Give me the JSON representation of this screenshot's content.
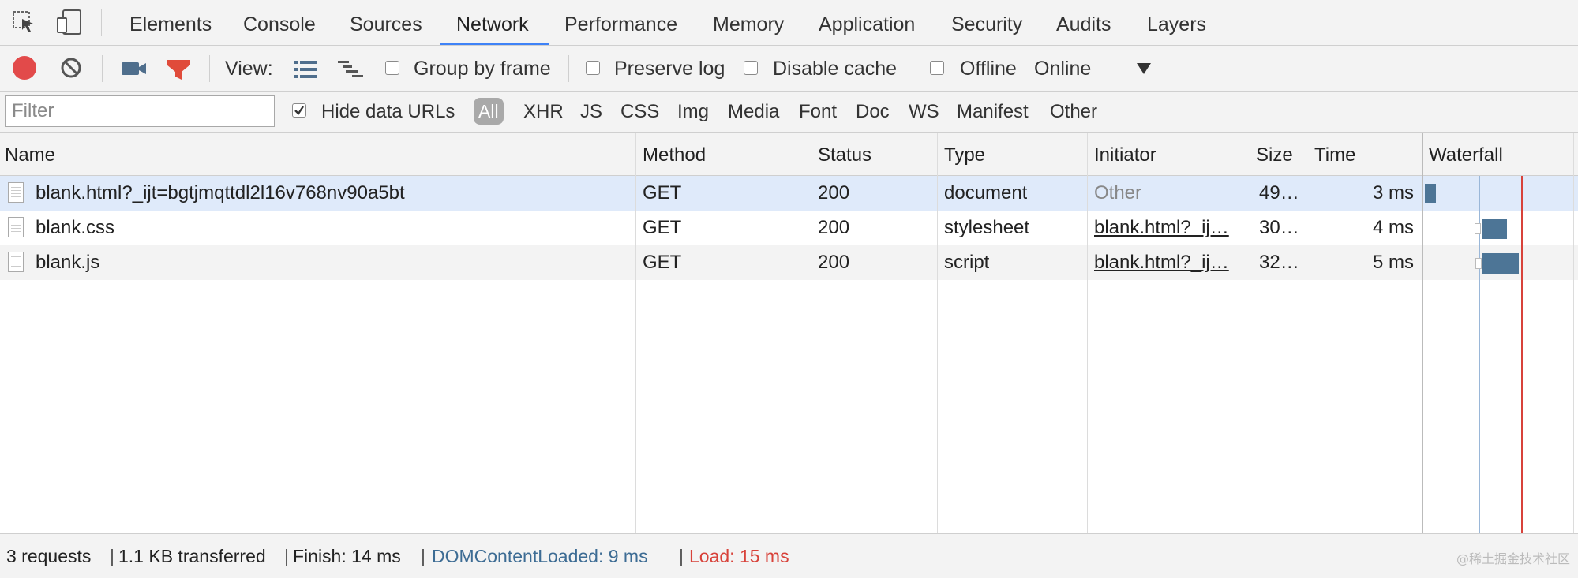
{
  "tabs": [
    {
      "label": "Elements"
    },
    {
      "label": "Console"
    },
    {
      "label": "Sources"
    },
    {
      "label": "Network",
      "active": true
    },
    {
      "label": "Performance"
    },
    {
      "label": "Memory"
    },
    {
      "label": "Application"
    },
    {
      "label": "Security"
    },
    {
      "label": "Audits"
    },
    {
      "label": "Layers"
    }
  ],
  "toolbar": {
    "view_label": "View:",
    "group_by_frame": "Group by frame",
    "preserve_log": "Preserve log",
    "disable_cache": "Disable cache",
    "offline": "Offline",
    "throttling": "Online"
  },
  "filter": {
    "placeholder": "Filter",
    "hide_data_urls": "Hide data URLs",
    "types": [
      "All",
      "XHR",
      "JS",
      "CSS",
      "Img",
      "Media",
      "Font",
      "Doc",
      "WS",
      "Manifest",
      "Other"
    ]
  },
  "columns": [
    "Name",
    "Method",
    "Status",
    "Type",
    "Initiator",
    "Size",
    "Time",
    "Waterfall"
  ],
  "rows": [
    {
      "name": "blank.html?_ijt=bgtjmqttdl2l16v768nv90a5bt",
      "method": "GET",
      "status": "200",
      "type": "document",
      "initiator": "Other",
      "size": "49…",
      "time": "3 ms"
    },
    {
      "name": "blank.css",
      "method": "GET",
      "status": "200",
      "type": "stylesheet",
      "initiator": "blank.html?_ij…",
      "size": "30…",
      "time": "4 ms"
    },
    {
      "name": "blank.js",
      "method": "GET",
      "status": "200",
      "type": "script",
      "initiator": "blank.html?_ij…",
      "size": "32…",
      "time": "5 ms"
    }
  ],
  "status": {
    "requests": "3 requests",
    "transferred": "1.1 KB transferred",
    "finish": "Finish: 14 ms",
    "dom_content_loaded": "DOMContentLoaded: 9 ms",
    "load": "Load: 15 ms"
  },
  "watermark": "@稀土掘金技术社区",
  "colors": {
    "accent": "#3e82f7",
    "record": "#e24a4a",
    "filter_icon": "#e04b3a",
    "dcl": "#3d6c94",
    "load": "#d8423a",
    "selected_row": "#dfeafa",
    "waterfall_bar": "#4d7596"
  }
}
